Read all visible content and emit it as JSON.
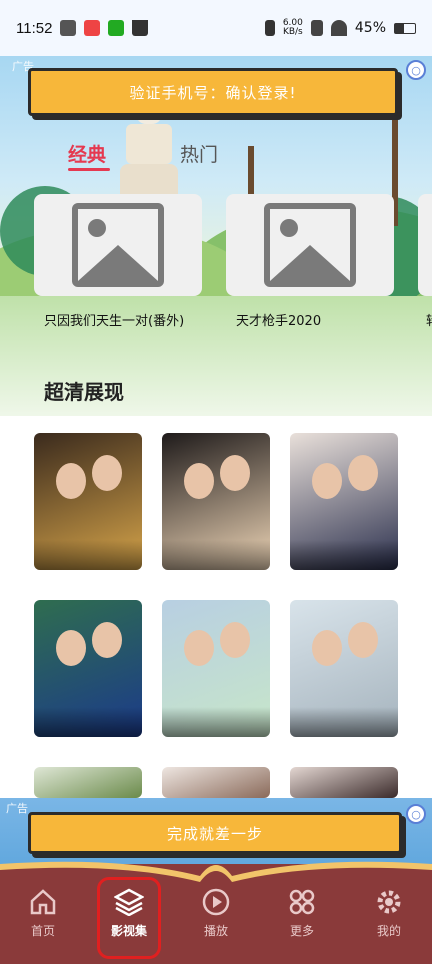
{
  "status_bar": {
    "time": "11:52",
    "speed_top": "6.00",
    "speed_unit": "KB/s",
    "battery": "45%"
  },
  "top_banner": {
    "ad_label": "广告",
    "text": "验证手机号：确认登录!"
  },
  "tabs": [
    {
      "label": "经典",
      "active": true
    },
    {
      "label": "热门",
      "active": false
    }
  ],
  "featured": [
    {
      "title": "只因我们天生一对(番外)"
    },
    {
      "title": "天才枪手2020"
    },
    {
      "title": "转"
    }
  ],
  "section": {
    "title": "超清展现"
  },
  "posters": [
    {
      "palette": "#3a2a1d",
      "accent": "#d7a54a"
    },
    {
      "palette": "#1e1a1a",
      "accent": "#f0d7b8"
    },
    {
      "palette": "#e9e0da",
      "accent": "#2a2f4d"
    },
    {
      "palette": "#2f6d4f",
      "accent": "#1b3a8a"
    },
    {
      "palette": "#b8cfe2",
      "accent": "#c7e6c9"
    },
    {
      "palette": "#d8e3ea",
      "accent": "#a5b3bd"
    },
    {
      "palette": "#dfe7d6",
      "accent": "#6a8a4a"
    },
    {
      "palette": "#eee6e1",
      "accent": "#8a6a5a"
    },
    {
      "palette": "#e4d7d2",
      "accent": "#3a2a2a"
    }
  ],
  "bottom_banner": {
    "ad_label": "广告",
    "text": "完成就差一步"
  },
  "bottom_nav": [
    {
      "label": "首页",
      "icon": "home-icon",
      "active": false
    },
    {
      "label": "影视集",
      "icon": "layers-icon",
      "active": true
    },
    {
      "label": "播放",
      "icon": "play-icon",
      "active": false
    },
    {
      "label": "更多",
      "icon": "grid-icon",
      "active": false
    },
    {
      "label": "我的",
      "icon": "gear-icon",
      "active": false
    }
  ],
  "colors": {
    "accent_red": "#e53950",
    "nav_bg": "#8a3a3a",
    "banner_yellow": "#f7b73a"
  }
}
